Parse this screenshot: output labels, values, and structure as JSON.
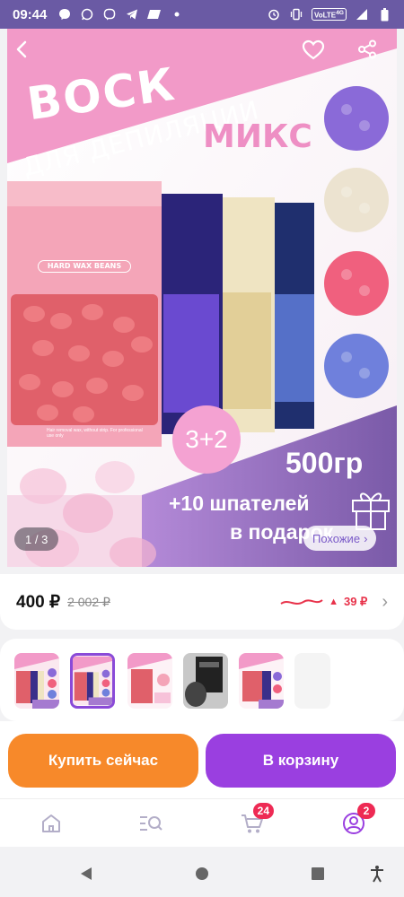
{
  "status_bar": {
    "time": "09:44",
    "network": "VoLTE",
    "network_suffix": "4G",
    "icons_left": [
      "messenger-icon",
      "whatsapp-icon",
      "viber-icon",
      "telegram-icon",
      "chat-icon",
      "dot-icon"
    ],
    "icons_right": [
      "alarm-icon",
      "vibrate-icon",
      "volte-icon",
      "signal-icon",
      "battery-icon"
    ]
  },
  "hero": {
    "title": "ВОСК",
    "subtitle": "ДЛЯ ДЕПИЛЯЦИИ",
    "variant_label": "МИКС",
    "pack_label": "HARD WAX BEANS",
    "pack_small_text": "Hair removal wax, without strip. For professional use only",
    "promo": "3+2",
    "weight": "500гр",
    "gift_line1": "+10 шпателей",
    "gift_line2": "в подарок",
    "page_indicator": "1 / 3",
    "similar_label": "Похожие",
    "similar_chevron": "›",
    "bean_colors": [
      "#8a6ad8",
      "#ece3d0",
      "#f0607e",
      "#6f80dc"
    ],
    "pack_colors": [
      "#f58c98",
      "#3a2f8a",
      "#f1e7c8",
      "#2a3a78"
    ]
  },
  "price": {
    "current": "400 ₽",
    "old": "2 002 ₽",
    "trend_arrow": "▲",
    "trend_value": "39 ₽",
    "chevron": "›"
  },
  "thumbnails": {
    "selected_index": 1,
    "count": 6
  },
  "actions": {
    "buy_now": "Купить сейчас",
    "add_to_cart": "В корзину"
  },
  "tab_bar": {
    "cart_badge": "24",
    "profile_badge": "2"
  },
  "colors": {
    "accent_purple": "#9a3fe0",
    "accent_orange": "#f7892a",
    "badge_red": "#ee2a54",
    "status_bar": "#6a5aa4"
  }
}
